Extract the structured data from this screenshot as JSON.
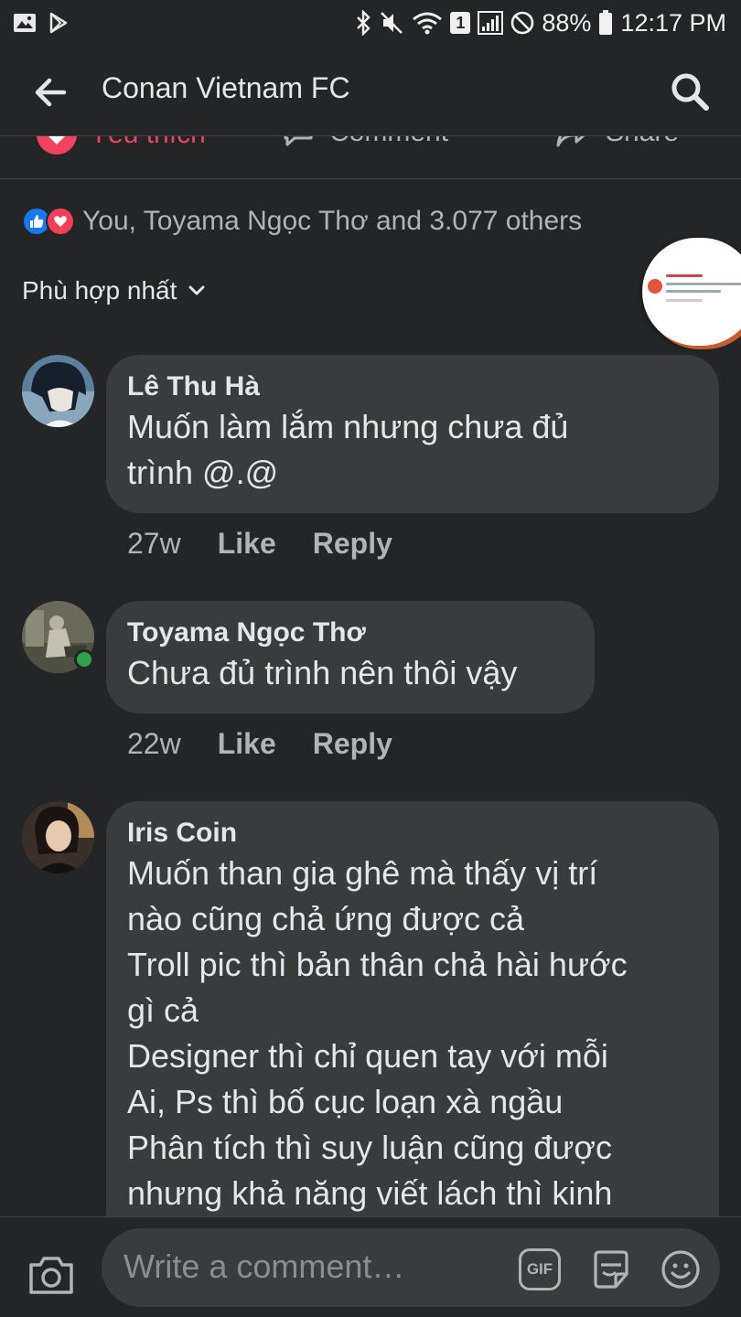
{
  "status_bar": {
    "battery": "88%",
    "time": "12:17 PM",
    "sim_badge": "1",
    "left_icons": [
      "gallery-icon",
      "play-store-icon"
    ],
    "right_icons": [
      "bluetooth-icon",
      "mute-icon",
      "wifi-icon",
      "signal-icon",
      "no-disturb-icon",
      "battery-icon"
    ]
  },
  "header": {
    "title": "Conan Vietnam FC"
  },
  "actions": {
    "like_label": "Yêu thích",
    "comment_label": "Comment",
    "share_label": "Share"
  },
  "reactions": {
    "text": "You, Toyama Ngọc Thơ and 3.077 others"
  },
  "sort": {
    "label": "Phù hợp nhất"
  },
  "comments": [
    {
      "author": "Lê Thu Hà",
      "text": "Muốn làm lắm nhưng chưa đủ\ntrình @.@",
      "time": "27w",
      "like": "Like",
      "reply": "Reply"
    },
    {
      "author": "Toyama Ngọc Thơ",
      "text": "Chưa đủ trình nên thôi vậy",
      "time": "22w",
      "like": "Like",
      "reply": "Reply",
      "online": true
    },
    {
      "author": "Iris Coin",
      "text": "Muốn than gia ghê mà thấy vị trí\nnào cũng chả ứng được cả\nTroll pic thì bản thân chả hài hước\ngì cả\nDesigner thì chỉ quen tay với mỗi\nAi, Ps thì bố cục loạn xà ngầu\nPhân tích thì suy luận cũng được\nnhưng khả năng viết lách thì kinh"
    }
  ],
  "composer": {
    "placeholder": "Write a comment…",
    "gif_label": "GIF"
  },
  "colors": {
    "background": "#242526",
    "bubble": "#3a3b3c",
    "love_accent": "#f3425f",
    "like_blue": "#1877f2",
    "online_green": "#31a24c"
  }
}
